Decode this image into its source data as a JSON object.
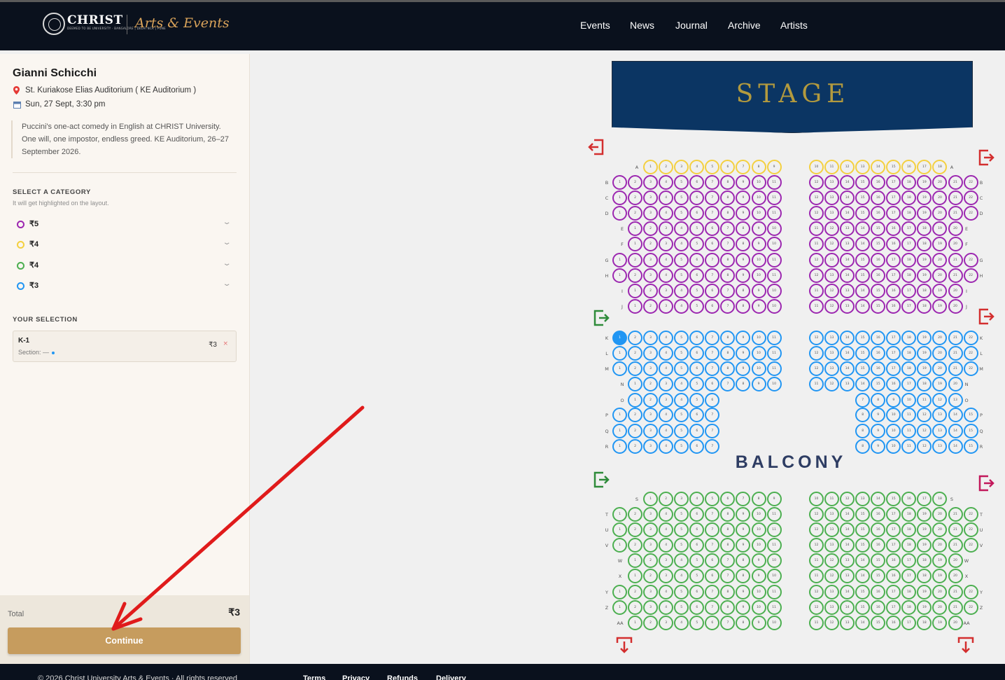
{
  "brand": {
    "name": "CHRIST",
    "sub": "DEEMED TO BE UNIVERSITY · BANGALORE | DELHI NCR | PUNE",
    "section": "Arts & Events"
  },
  "nav": [
    "Events",
    "News",
    "Journal",
    "Archive",
    "Artists"
  ],
  "event": {
    "title": "Gianni Schicchi",
    "venue": "St. Kuriakose Elias Auditorium ( KE Auditorium )",
    "datetime": "Sun, 27 Sept, 3:30 pm",
    "description": "Puccini's one-act comedy in English at CHRIST University. One will, one impostor, endless greed. KE Auditorium, 26–27 September 2026."
  },
  "category_section": {
    "heading": "SELECT A CATEGORY",
    "hint": "It will get highlighted on the layout."
  },
  "categories": [
    {
      "price": "₹5",
      "color": "#9c27b0"
    },
    {
      "price": "₹4",
      "color": "#f4d03f"
    },
    {
      "price": "₹4",
      "color": "#4caf50"
    },
    {
      "price": "₹3",
      "color": "#2196f3"
    }
  ],
  "selection": {
    "heading": "YOUR SELECTION",
    "seat": "K-1",
    "section": "Section: —",
    "price": "₹3",
    "remove": "×"
  },
  "total": {
    "label": "Total",
    "value": "₹3"
  },
  "continue_label": "Continue",
  "map": {
    "stage_label": "STAGE",
    "balcony_label": "BALCONY",
    "selected_seat": "K-1"
  },
  "colors": {
    "purple": "#9c27b0",
    "yellow": "#f4d03f",
    "blue": "#2196f3",
    "green": "#4caf50",
    "exit_red": "#d32f2f",
    "exit_green": "#2e8b3a",
    "exit_magenta": "#c2185b"
  },
  "footer": {
    "copyright": "© 2026 Christ University Arts & Events · All rights reserved",
    "links": [
      "Terms",
      "Privacy",
      "Refunds",
      "Delivery"
    ]
  }
}
